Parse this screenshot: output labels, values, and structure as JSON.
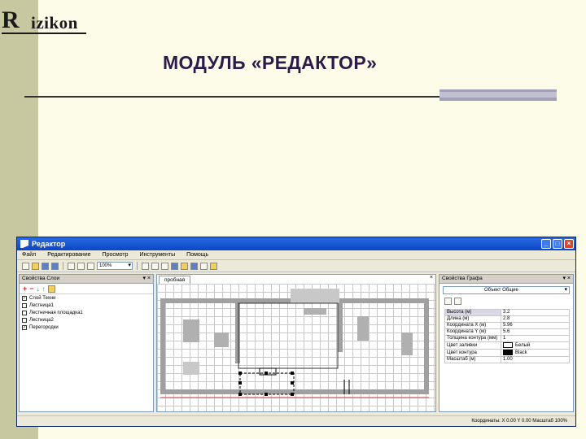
{
  "slide": {
    "logo_mark": "R",
    "logo_word": "izikon",
    "title": "МОДУЛЬ «РЕДАКТОР»"
  },
  "window": {
    "title": "Редактор",
    "minimize": "_",
    "maximize": "□",
    "close": "×"
  },
  "menu": [
    {
      "label": "Файл"
    },
    {
      "label": "Редактирование"
    },
    {
      "label": "Просмотр"
    },
    {
      "label": "Инструменты"
    },
    {
      "label": "Помощь"
    }
  ],
  "toolbar": {
    "zoom_value": "100%"
  },
  "layers_panel": {
    "title": "Свойства Слои",
    "pin": "▾ ×",
    "items": [
      {
        "label": "Слой Техни",
        "checked": true
      },
      {
        "label": "Лестница1",
        "checked": false
      },
      {
        "label": "Лестничная площадка1",
        "checked": false
      },
      {
        "label": "Лестница2",
        "checked": false
      },
      {
        "label": "Перегородки",
        "checked": true
      }
    ]
  },
  "document": {
    "tab": "пробная",
    "close": "×"
  },
  "properties_panel": {
    "title": "Свойства Графа",
    "pin": "▾ ×",
    "combo_value": "Объект Общие",
    "rows": [
      {
        "key": "Высота (м)",
        "value": "3.2"
      },
      {
        "key": "Длина (м)",
        "value": "2.8"
      },
      {
        "key": "Координата X (м)",
        "value": "5.96"
      },
      {
        "key": "Координата Y (м)",
        "value": "5.6"
      },
      {
        "key": "Толщина контура (мм)",
        "value": "1"
      },
      {
        "key": "Цвет заливки",
        "value": "Белый",
        "swatch": "#ffffff"
      },
      {
        "key": "Цвет контура",
        "value": "Black",
        "swatch": "#000000"
      },
      {
        "key": "Масштаб (м)",
        "value": "1.00"
      }
    ]
  },
  "status": {
    "text": "Координаты: X 0.00  Y 0.00  Масштаб 100%"
  },
  "colors": {
    "accent": "#2b1a4a",
    "titlebar": "#0a46c8",
    "wall": "#a0a0a0"
  }
}
